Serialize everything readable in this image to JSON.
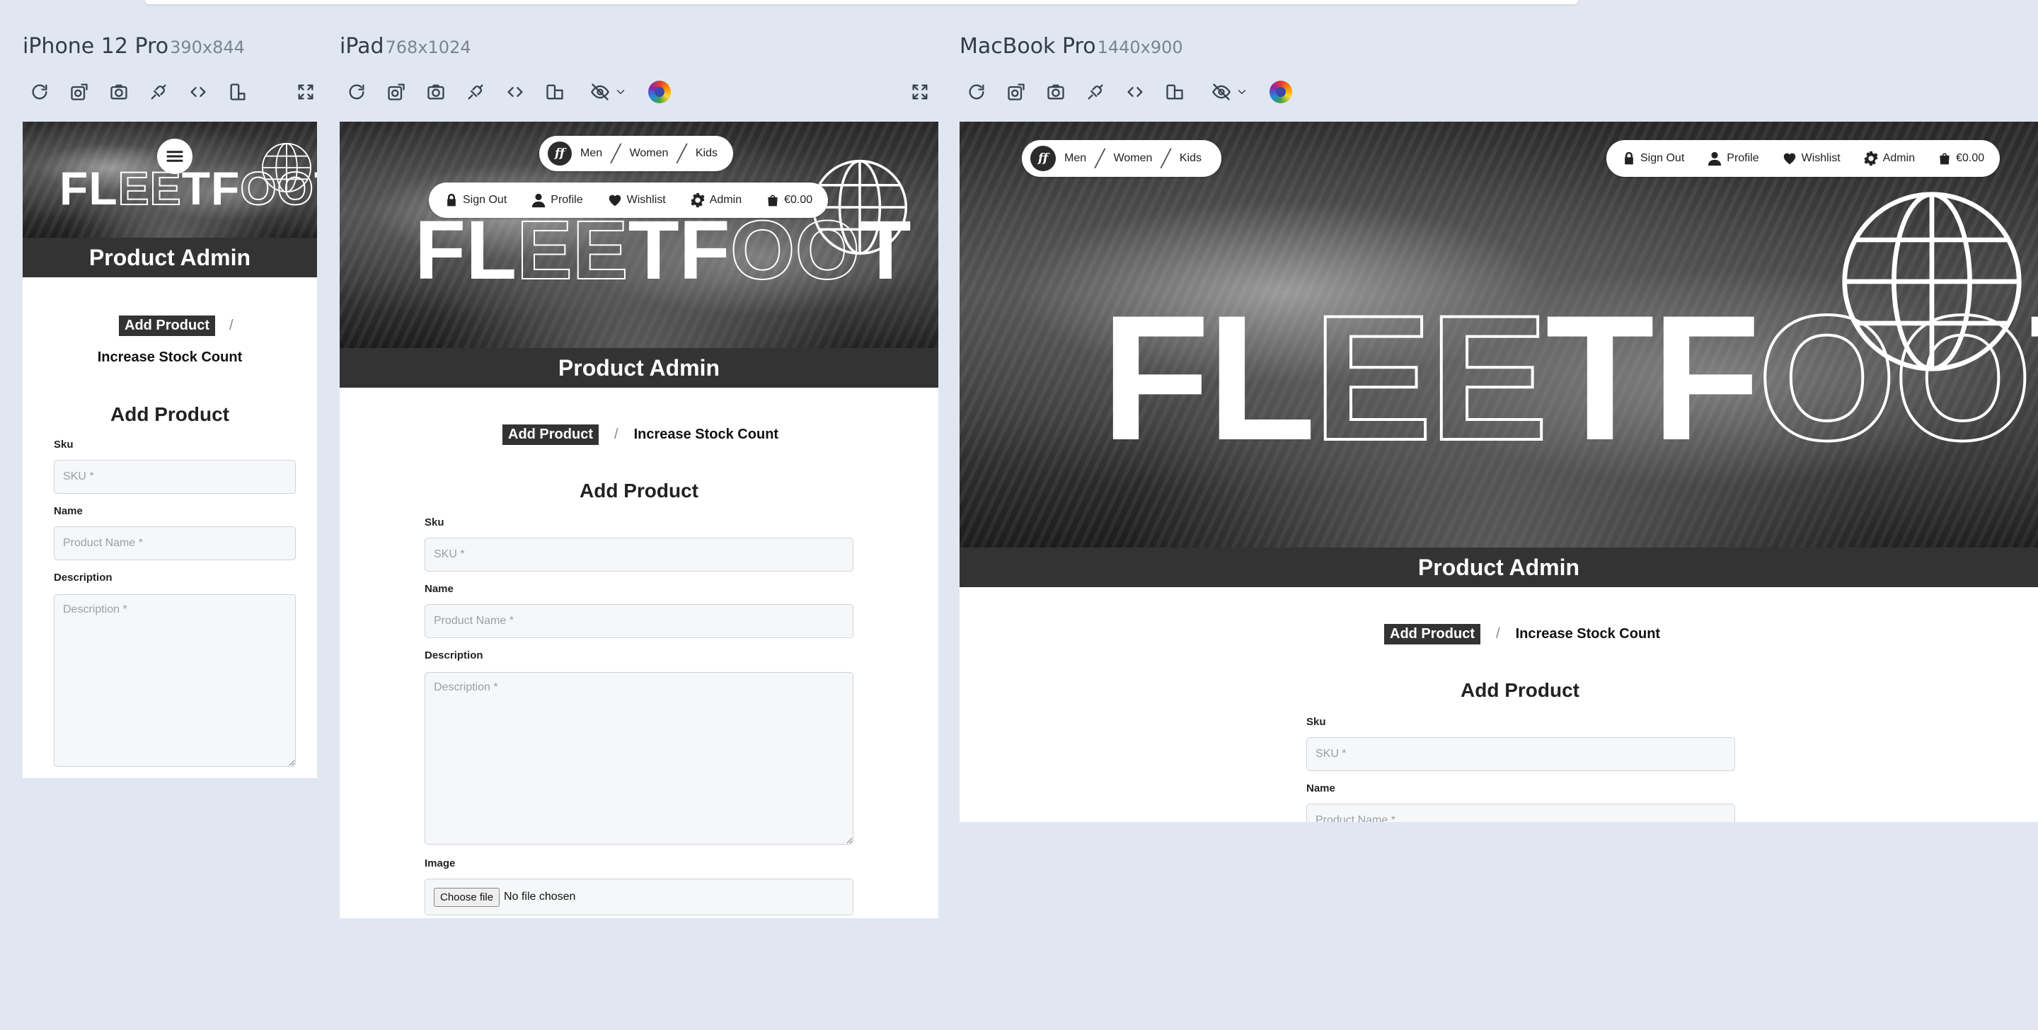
{
  "devices": [
    {
      "name": "iPhone 12 Pro",
      "dims": "390x844"
    },
    {
      "name": "iPad",
      "dims": "768x1024"
    },
    {
      "name": "MacBook Pro",
      "dims": "1440x900"
    }
  ],
  "toolbar_icons": [
    "reload-icon",
    "screenshot-full-icon",
    "camera-icon",
    "link-sync-icon",
    "code-icon",
    "rotate-device-icon",
    "eye-off-icon",
    "chevron-down-icon",
    "color-wheel-icon",
    "fullscreen-icon"
  ],
  "site": {
    "logo_letters": {
      "a": "FL",
      "b": "EE",
      "c": "TF",
      "d": "OO",
      "e": "T"
    },
    "brand_mark": "ff",
    "nav": {
      "men": "Men",
      "women": "Women",
      "kids": "Kids"
    },
    "account": {
      "sign_out": "Sign Out",
      "profile": "Profile",
      "wishlist": "Wishlist",
      "admin": "Admin",
      "cart": "€0.00"
    },
    "page_heading": "Product Admin",
    "tabs": {
      "add": "Add Product",
      "sep": "/",
      "stock": "Increase Stock Count"
    },
    "form": {
      "title": "Add Product",
      "sku_label": "Sku",
      "sku_placeholder": "SKU *",
      "name_label": "Name",
      "name_placeholder": "Product Name *",
      "desc_label": "Description",
      "desc_placeholder": "Description *",
      "image_label": "Image",
      "file_button": "Choose file",
      "file_status": "No file chosen"
    }
  }
}
